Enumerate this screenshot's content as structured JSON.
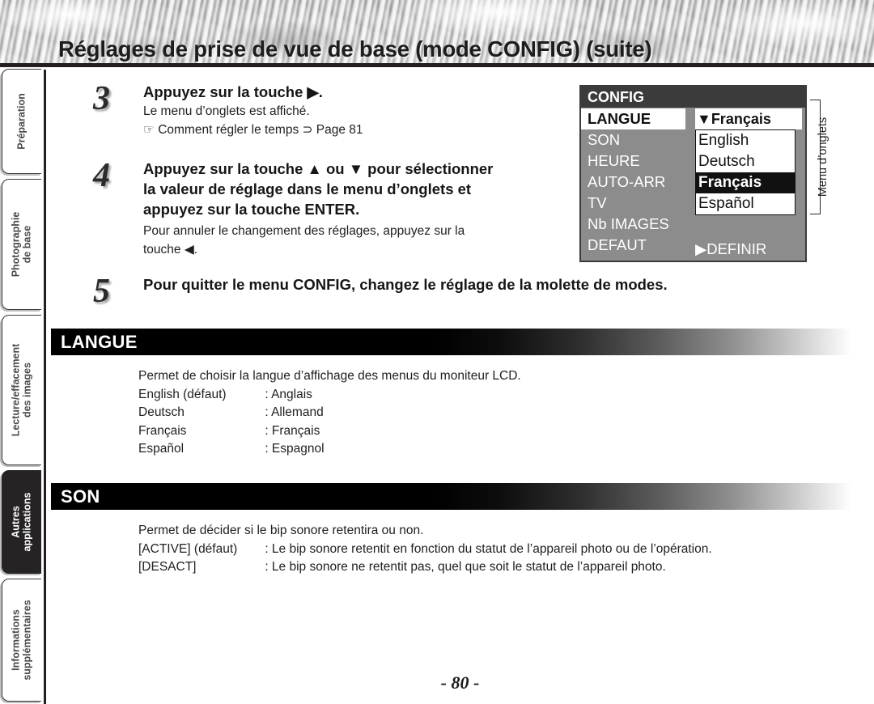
{
  "header": {
    "title": "Réglages de prise de vue de base (mode CONFIG) (suite)"
  },
  "sidebar": {
    "tabs": [
      {
        "label": "Préparation",
        "active": false
      },
      {
        "label": "Photographie\nde base",
        "active": false
      },
      {
        "label": "Lecture/effacement\ndes images",
        "active": false
      },
      {
        "label": "Autres\napplications",
        "active": true
      },
      {
        "label": "Informations\nsupplémentaires",
        "active": false
      }
    ]
  },
  "steps": [
    {
      "number": "3",
      "heading": "Appuyez sur la touche ▶.",
      "lines": [
        "Le menu d’onglets est affiché.",
        "☞ Comment régler le temps ⊃ Page 81"
      ]
    },
    {
      "number": "4",
      "heading_lines": [
        "Appuyez sur la touche ▲ ou ▼ pour sélectionner",
        "la valeur de réglage dans le menu d’onglets et",
        "appuyez sur la touche ENTER."
      ],
      "lines": [
        "Pour annuler le changement des réglages, appuyez sur la",
        "touche ◀."
      ]
    },
    {
      "number": "5",
      "heading": "Pour quitter le menu CONFIG, changez le réglage de la molette de modes."
    }
  ],
  "lcd": {
    "title": "CONFIG",
    "items": [
      {
        "label": "LANGUE",
        "selected": true
      },
      {
        "label": "SON",
        "selected": false
      },
      {
        "label": "HEURE",
        "selected": false
      },
      {
        "label": "AUTO-ARR",
        "selected": false
      },
      {
        "label": "TV",
        "selected": false
      },
      {
        "label": "Nb IMAGES",
        "selected": false
      },
      {
        "label": "DEFAUT",
        "selected": false
      }
    ],
    "current_value": "▼Français",
    "options": [
      {
        "label": "English",
        "highlighted": false
      },
      {
        "label": "Deutsch",
        "highlighted": false
      },
      {
        "label": "Français",
        "highlighted": true
      },
      {
        "label": "Español",
        "highlighted": false
      }
    ],
    "definir": "▶DEFINIR",
    "callout": "Menu d’onglets"
  },
  "sections": [
    {
      "name": "LANGUE",
      "intro": "Permet de choisir la langue d’affichage des menus du moniteur LCD.",
      "rows": [
        {
          "key": "English (défaut)",
          "value": ": Anglais"
        },
        {
          "key": "Deutsch",
          "value": ": Allemand"
        },
        {
          "key": "Français",
          "value": ": Français"
        },
        {
          "key": "Español",
          "value": ": Espagnol"
        }
      ]
    },
    {
      "name": "SON",
      "intro": "Permet de décider si le bip sonore retentira ou non.",
      "rows": [
        {
          "key": "[ACTIVE] (défaut)",
          "value": ": Le bip sonore retentit en fonction du statut de l’appareil photo ou de l’opération."
        },
        {
          "key": "[DESACT]",
          "value": ": Le bip sonore ne retentit pas, quel que soit le statut de l’appareil photo."
        }
      ]
    }
  ],
  "footer": {
    "page_number": "- 80 -"
  },
  "colors": {
    "ink": "#1a1a1a",
    "rule": "#231f20",
    "lcd_bg": "#8c8c8c",
    "lcd_title_bg": "#3b3b3b",
    "active_tab_bg": "#262324"
  }
}
